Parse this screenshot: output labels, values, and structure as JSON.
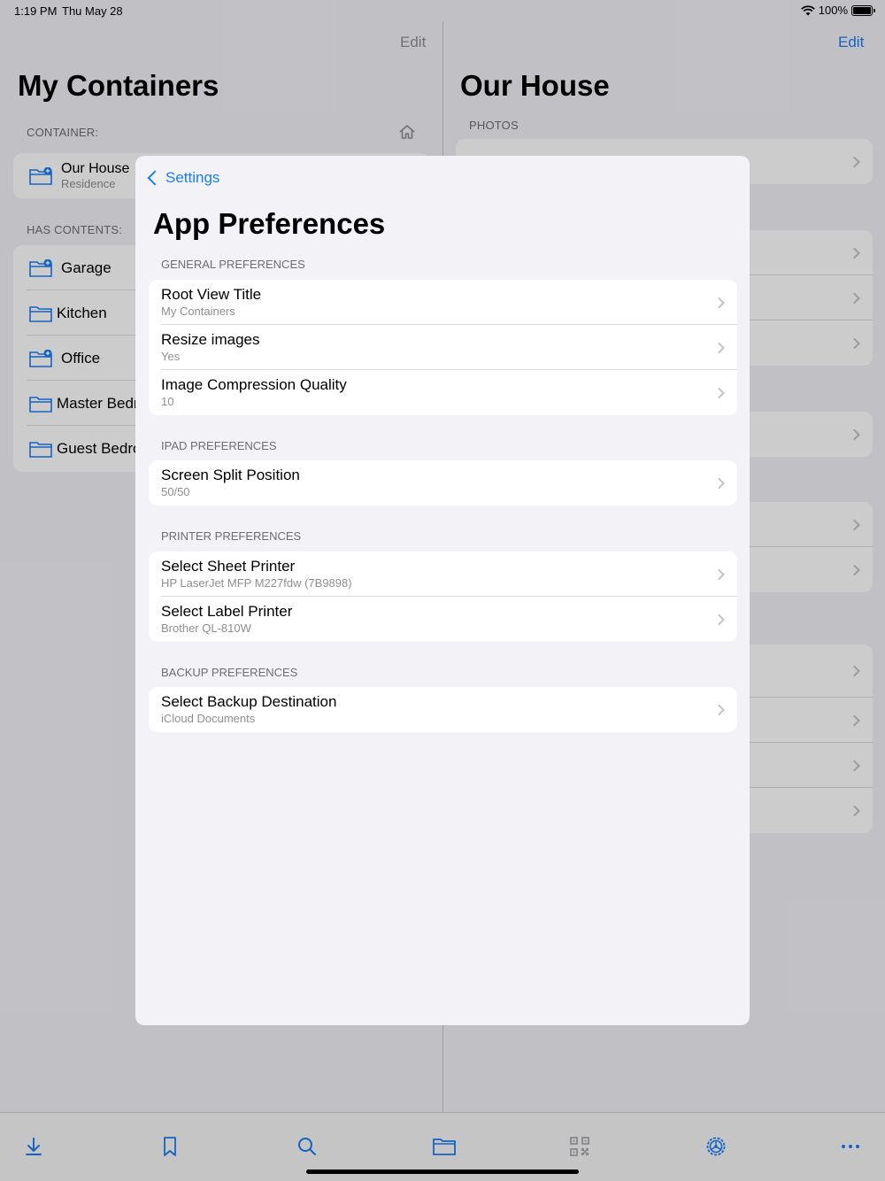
{
  "status": {
    "time": "1:19 PM",
    "date": "Thu May 28",
    "battery": "100%"
  },
  "left": {
    "edit": "Edit",
    "title": "My Containers",
    "container_header": "CONTAINER:",
    "container": {
      "name": "Our House",
      "type": "Residence"
    },
    "contents_header": "HAS CONTENTS:",
    "items": [
      {
        "label": "Garage",
        "badge": true
      },
      {
        "label": "Kitchen",
        "badge": false
      },
      {
        "label": "Office",
        "badge": true
      },
      {
        "label": "Master Bedroom",
        "badge": false
      },
      {
        "label": "Guest Bedroom",
        "badge": false
      }
    ]
  },
  "right": {
    "edit": "Edit",
    "title": "Our House",
    "photos_header": "PHOTOS"
  },
  "modal": {
    "back_label": "Settings",
    "title": "App Preferences",
    "sections": [
      {
        "header": "GENERAL PREFERENCES",
        "rows": [
          {
            "title": "Root View Title",
            "value": "My Containers"
          },
          {
            "title": "Resize images",
            "value": "Yes"
          },
          {
            "title": "Image Compression Quality",
            "value": "10"
          }
        ]
      },
      {
        "header": "IPAD PREFERENCES",
        "rows": [
          {
            "title": "Screen Split Position",
            "value": "50/50"
          }
        ]
      },
      {
        "header": "PRINTER PREFERENCES",
        "rows": [
          {
            "title": "Select Sheet Printer",
            "value": "HP LaserJet MFP M227fdw (7B9898)"
          },
          {
            "title": "Select Label Printer",
            "value": "Brother QL-810W"
          }
        ]
      },
      {
        "header": "BACKUP PREFERENCES",
        "rows": [
          {
            "title": "Select Backup Destination",
            "value": "iCloud Documents"
          }
        ]
      }
    ]
  },
  "tabbar": [
    "download-icon",
    "bookmark-icon",
    "search-icon",
    "folder-icon",
    "qr-code-icon",
    "settings-gear-icon",
    "more-icon"
  ],
  "colors": {
    "accent": "#1a7cf6",
    "background": "#f2f2f7",
    "secondary_text": "#8e8e93"
  }
}
